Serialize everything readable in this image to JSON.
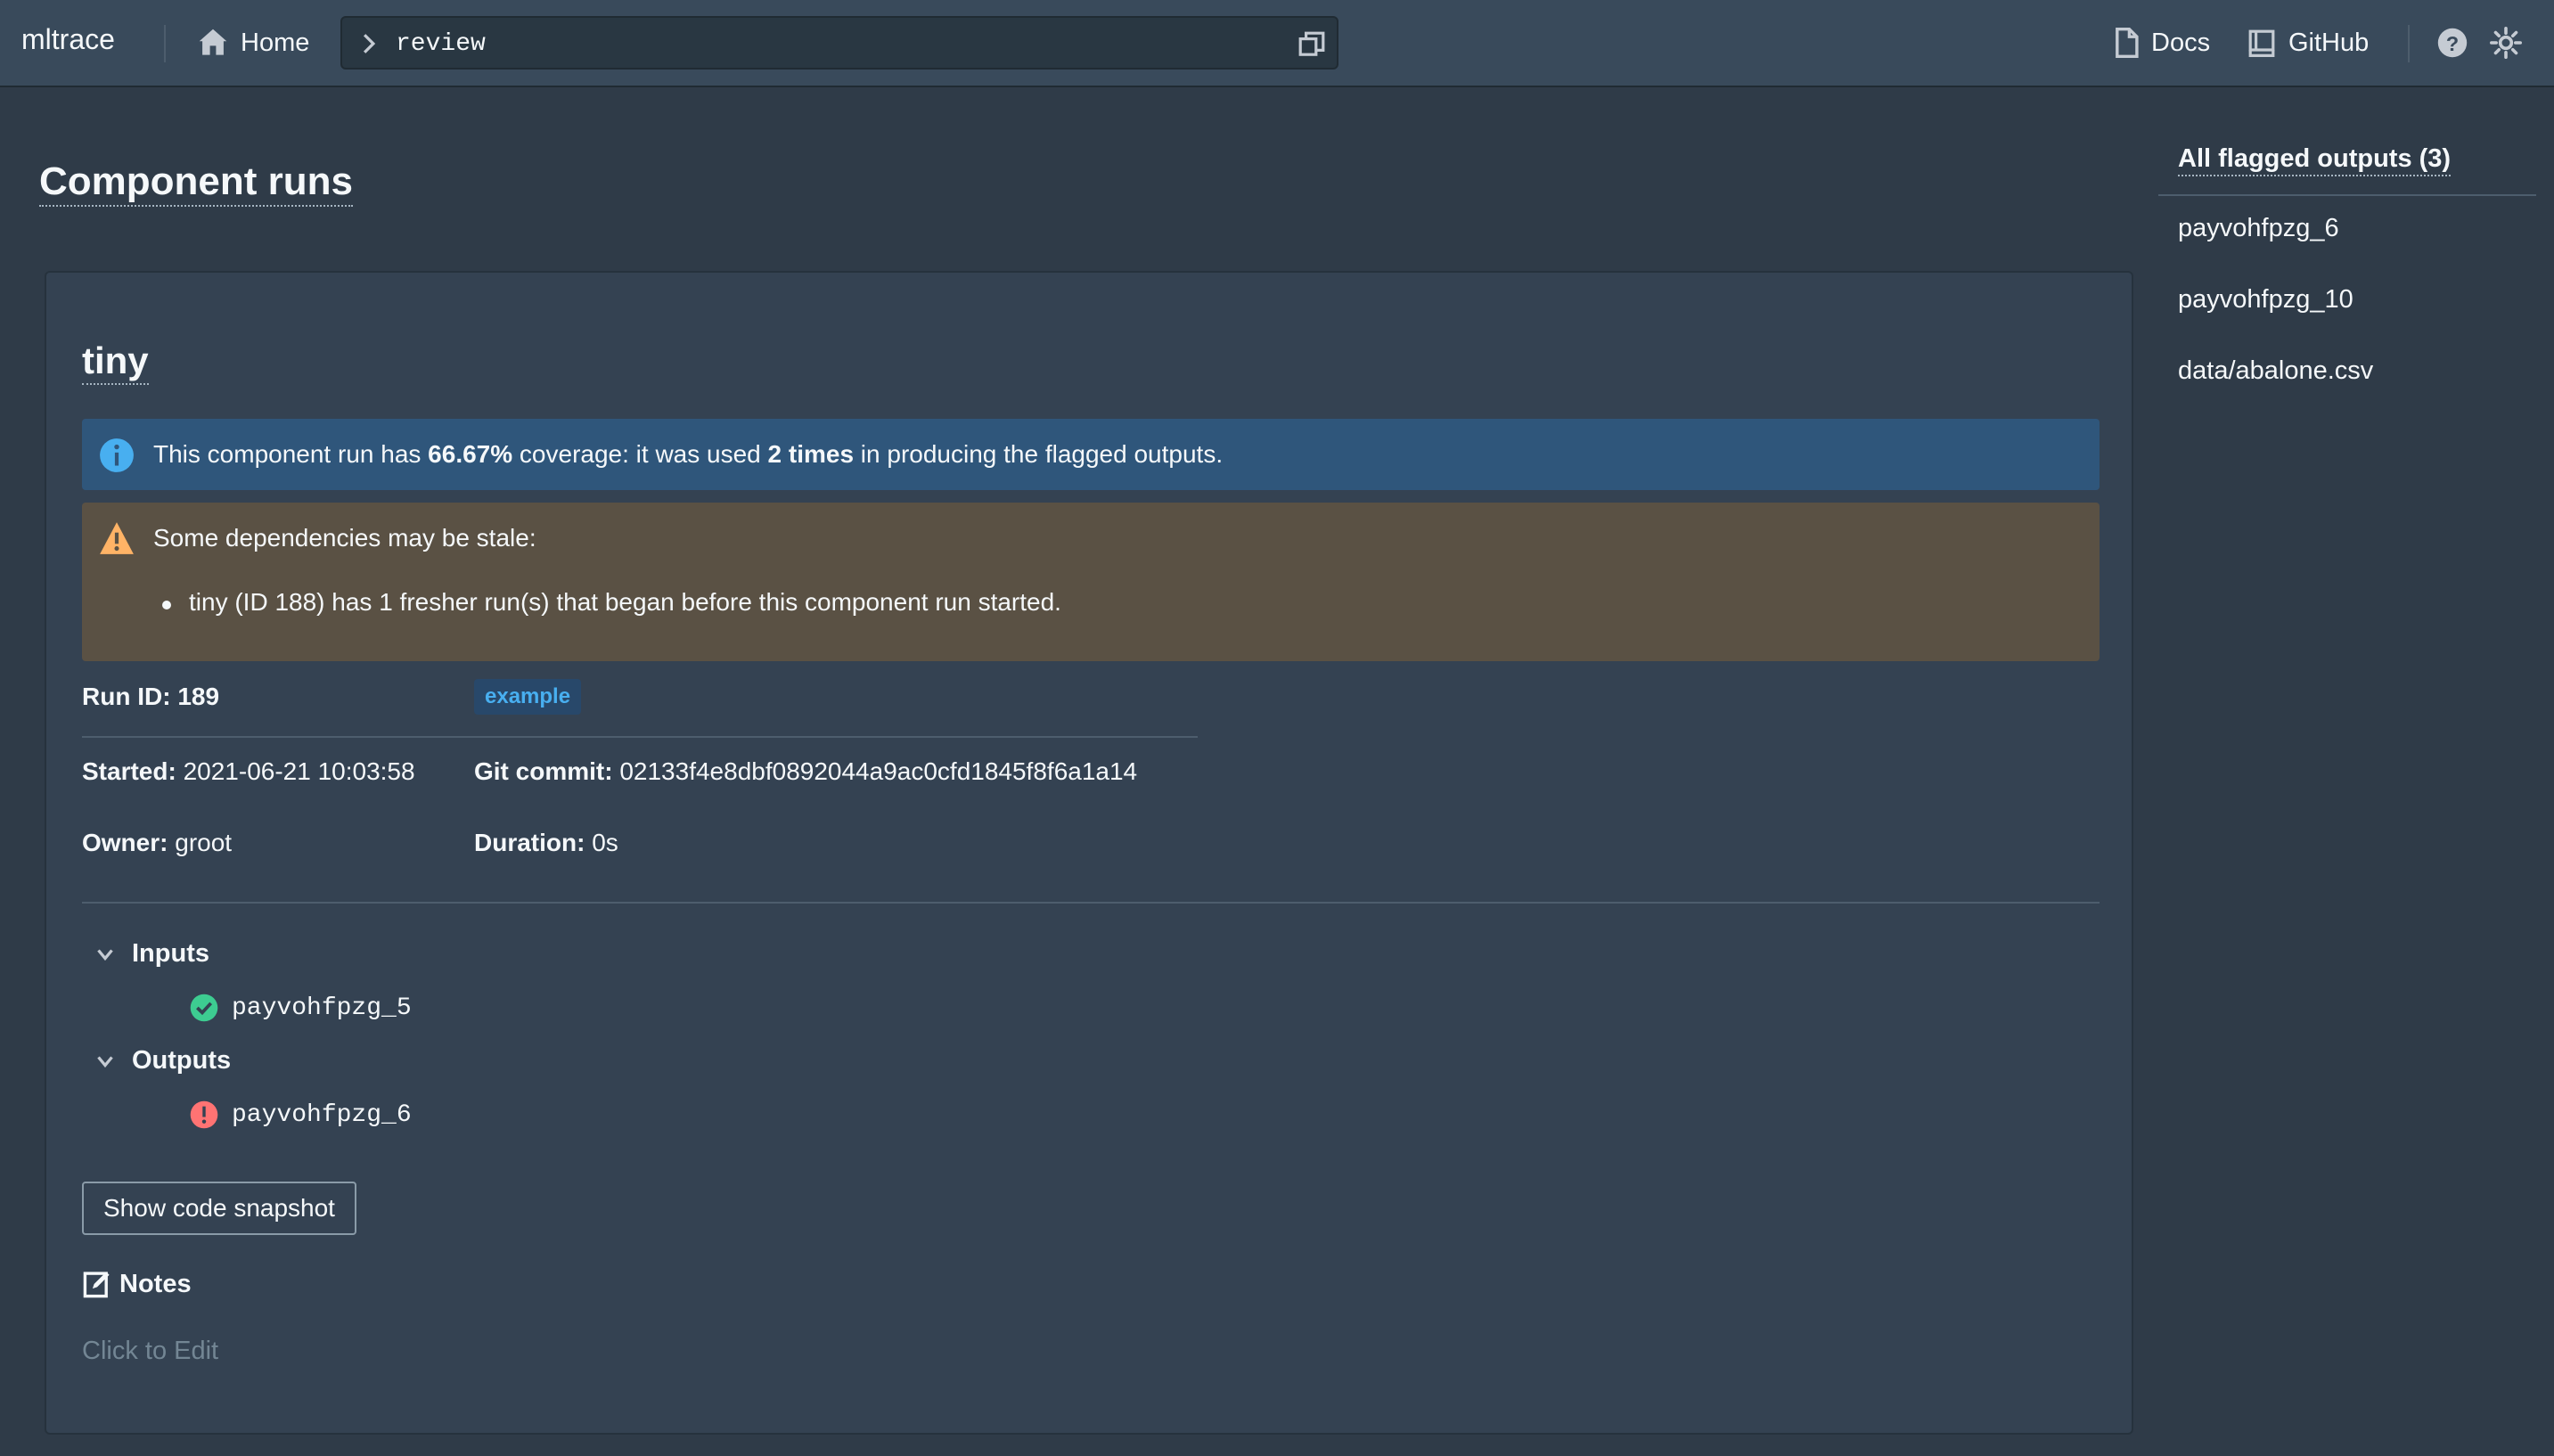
{
  "nav": {
    "brand": "mltrace",
    "home_label": "Home",
    "breadcrumb": "review",
    "docs_label": "Docs",
    "github_label": "GitHub"
  },
  "page": {
    "title": "Component runs"
  },
  "run": {
    "name": "tiny",
    "coverage": {
      "prefix": "This component run has ",
      "percent": "66.67%",
      "middle": " coverage: it was used ",
      "times": "2 times",
      "suffix": " in producing the flagged outputs."
    },
    "stale": {
      "heading": "Some dependencies may be stale:",
      "items": [
        "tiny (ID 188) has 1 fresher run(s) that began before this component run started."
      ]
    },
    "run_id_label": "Run ID:",
    "run_id": "189",
    "tag": "example",
    "started_label": "Started:",
    "started": "2021-06-21 10:03:58",
    "git_label": "Git commit:",
    "git_commit": "02133f4e8dbf0892044a9ac0cfd1845f8f6a1a14",
    "owner_label": "Owner:",
    "owner": "groot",
    "duration_label": "Duration:",
    "duration": "0s",
    "inputs_label": "Inputs",
    "inputs": [
      {
        "name": "payvohfpzg_5",
        "status": "ok"
      }
    ],
    "outputs_label": "Outputs",
    "outputs": [
      {
        "name": "payvohfpzg_6",
        "status": "flagged"
      }
    ],
    "snapshot_button": "Show code snapshot",
    "notes_label": "Notes",
    "notes_placeholder": "Click to Edit"
  },
  "sidebar": {
    "title": "All flagged outputs (3)",
    "items": [
      "payvohfpzg_6",
      "payvohfpzg_10",
      "data/abalone.csv"
    ]
  },
  "colors": {
    "background": "#2f3b48",
    "navbar": "#394a5b",
    "card": "#344252",
    "info_callout": "#2f567b",
    "warning_callout": "#5a5144",
    "success": "#3dcc91",
    "danger": "#ff7373",
    "tag_text": "#48aff0"
  },
  "icons": [
    "home-icon",
    "chevron-right-icon",
    "duplicate-icon",
    "document-icon",
    "book-icon",
    "help-icon",
    "flash-icon",
    "info-sign-icon",
    "warning-sign-icon",
    "chevron-down-icon",
    "tick-circle-icon",
    "error-icon",
    "edit-icon"
  ]
}
